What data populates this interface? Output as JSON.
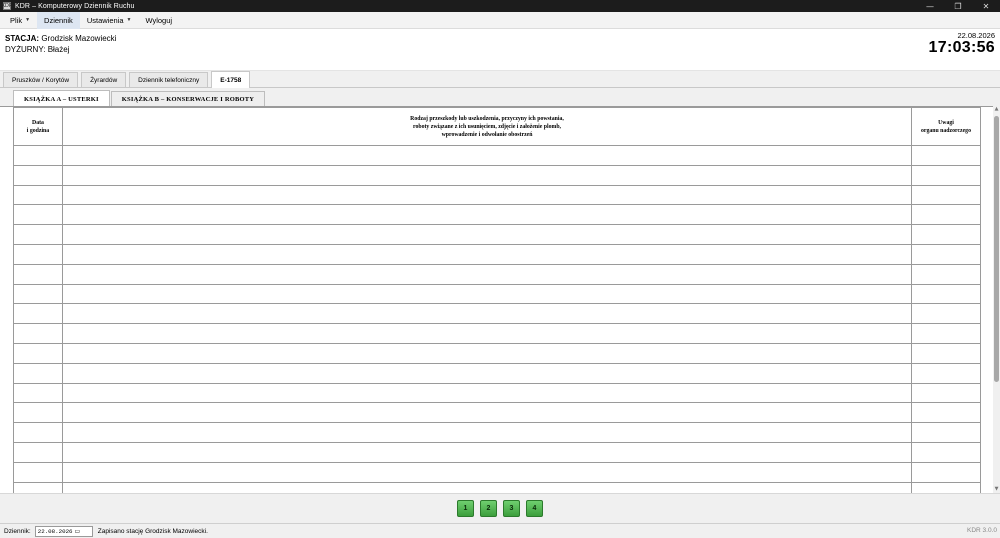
{
  "window": {
    "title": "KDR – Komputerowy Dziennik Ruchu",
    "icon": "app-icon",
    "icon_glyph": "KDR",
    "controls": {
      "minimize": "—",
      "maximize": "❐",
      "close": "✕"
    }
  },
  "menu": {
    "items": [
      {
        "label": "Plik",
        "has_dropdown": true
      },
      {
        "label": "Dziennik",
        "has_dropdown": false,
        "active": true
      },
      {
        "label": "Ustawienia",
        "has_dropdown": true
      },
      {
        "label": "Wyloguj",
        "has_dropdown": false
      }
    ],
    "dropdown_glyph": "▼"
  },
  "header": {
    "station_label": "STACJA:",
    "station_value": "Grodzisk Mazowiecki",
    "duty_label": "DYŻURNY:",
    "duty_value": "Błażej",
    "date": "22.08.2026",
    "time": "17:03:56"
  },
  "main_tabs": [
    {
      "label": "Pruszków / Korytów"
    },
    {
      "label": "Żyrardów"
    },
    {
      "label": "Dziennik telefoniczny"
    },
    {
      "label": "E-1758",
      "active": true
    }
  ],
  "sub_tabs": [
    {
      "label": "KSIĄŻKA A – USTERKI",
      "active": true
    },
    {
      "label": "KSIĄŻKA B – KONSERWACJE I ROBOTY"
    }
  ],
  "table": {
    "columns": [
      {
        "lines": [
          "Data",
          "i godzina"
        ]
      },
      {
        "lines": [
          "Rodzaj przeszkody lub uszkodzenia, przyczyny ich powstania,",
          "roboty związane z ich usunięciem, zdjęcie i założenie plomb,",
          "wprowadzenie i odwołanie obostrzeń"
        ]
      },
      {
        "lines": [
          "Uwagi",
          "organu nadzorczego"
        ]
      }
    ],
    "empty_rows": 18
  },
  "pagination": {
    "pages": [
      "1",
      "2",
      "3",
      "4"
    ]
  },
  "statusbar": {
    "label": "Dziennik:",
    "date_value": "22.08.2026",
    "message": "Zapisano stację Grodzisk Mazowiecki.",
    "version": "KDR 3.0.0"
  },
  "scrollbar": {
    "up_glyph": "▲",
    "down_glyph": "▼"
  },
  "icons": {
    "calendar": "calendar-icon",
    "dropdown": "chevron-down-icon"
  }
}
